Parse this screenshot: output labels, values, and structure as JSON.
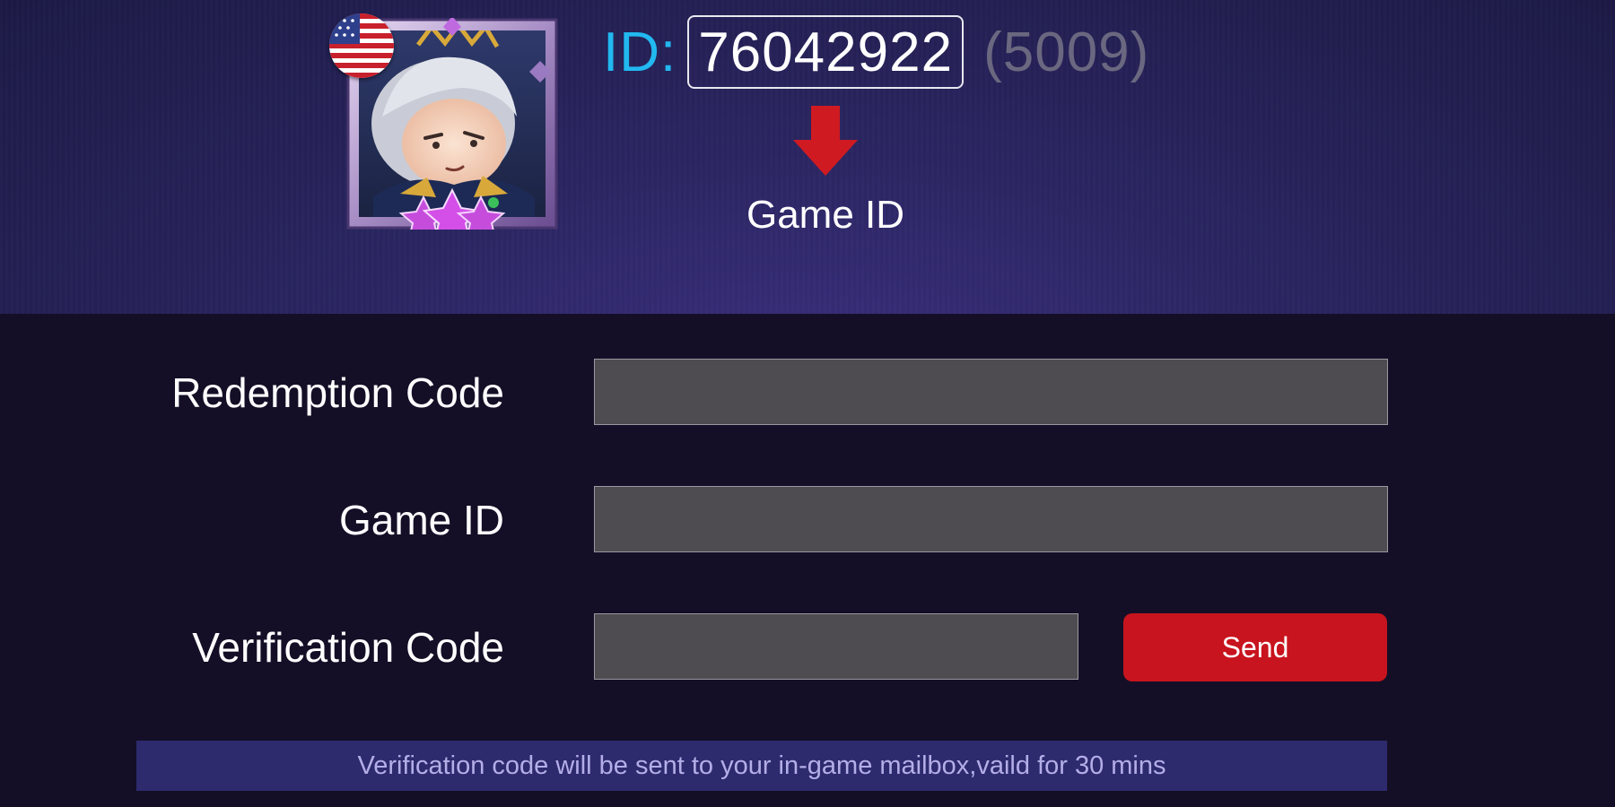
{
  "profile": {
    "id_label": "ID:",
    "id_value": "76042922",
    "server": "(5009)",
    "arrow_caption": "Game ID",
    "flag": "us-flag-icon",
    "avatar": "hero-avatar-icon"
  },
  "form": {
    "redemption_label": "Redemption Code",
    "redemption_value": "",
    "game_id_label": "Game ID",
    "game_id_value": "",
    "verification_label": "Verification Code",
    "verification_value": "",
    "send_label": "Send",
    "notice": "Verification code will be sent to your in-game mailbox,vaild for 30 mins"
  },
  "colors": {
    "id_label": "#22b8f0",
    "send_button": "#c8141e",
    "notice_bg": "#2e2a6e",
    "input_bg": "#4e4c50",
    "arrow": "#d01a22"
  }
}
